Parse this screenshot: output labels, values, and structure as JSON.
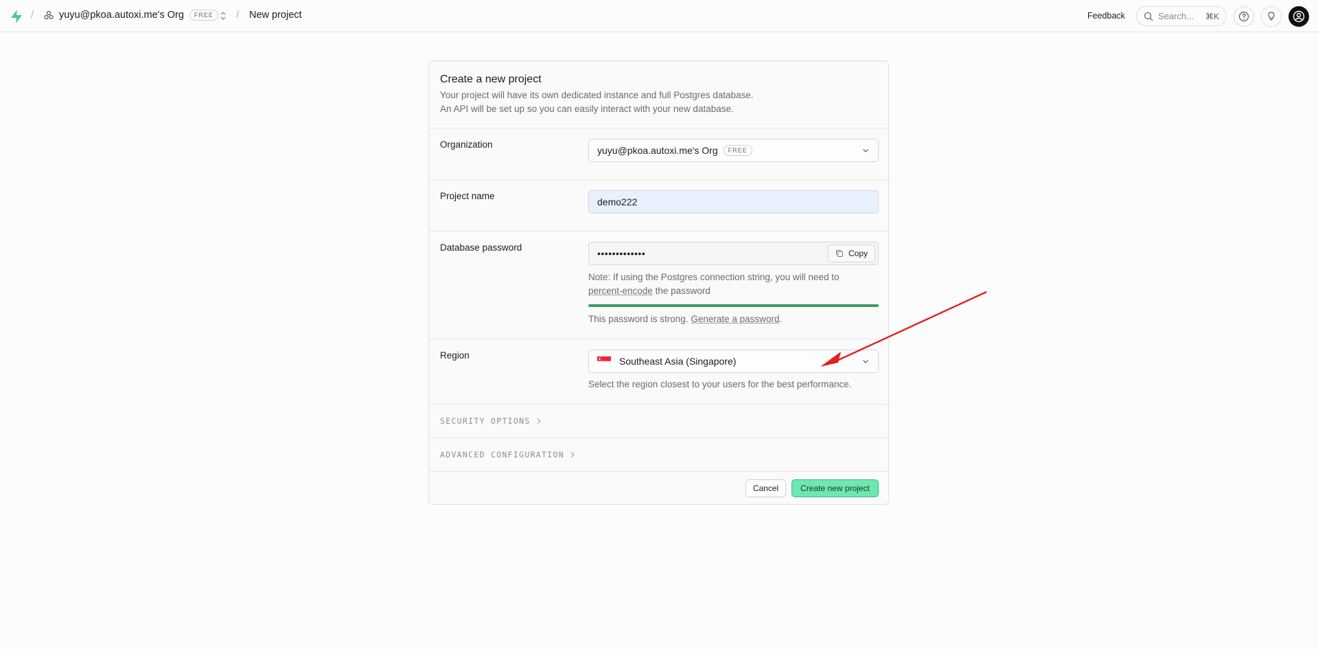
{
  "topbar": {
    "separator": "/",
    "org_name": "yuyu@pkoa.autoxi.me's Org",
    "org_badge": "FREE",
    "project_crumb": "New project",
    "feedback_label": "Feedback",
    "search_placeholder": "Search...",
    "search_shortcut": "⌘K"
  },
  "card": {
    "title": "Create a new project",
    "description_line1": "Your project will have its own dedicated instance and full Postgres database.",
    "description_line2": "An API will be set up so you can easily interact with your new database."
  },
  "form": {
    "organization": {
      "label": "Organization",
      "value": "yuyu@pkoa.autoxi.me's Org",
      "badge": "FREE"
    },
    "project_name": {
      "label": "Project name",
      "value": "demo222"
    },
    "database_password": {
      "label": "Database password",
      "masked_value": "•••••••••••••",
      "copy_label": "Copy",
      "note_part1": "Note: If using the Postgres connection string, you will need to",
      "note_link": "percent-encode",
      "note_part2": "the password",
      "strength_fraction": 1.0,
      "strength_text": "This password is strong.",
      "generate_link": "Generate a password",
      "generate_suffix": "."
    },
    "region": {
      "label": "Region",
      "value": "Southeast Asia (Singapore)",
      "hint": "Select the region closest to your users for the best performance."
    },
    "security_options_label": "SECURITY OPTIONS",
    "advanced_configuration_label": "ADVANCED CONFIGURATION"
  },
  "actions": {
    "cancel_label": "Cancel",
    "create_label": "Create new project"
  },
  "colors": {
    "brand_green": "#3ecf8e",
    "create_button": "#6ee7b0",
    "strength_bar": "#3b9b6a",
    "annotation_arrow": "#e02020"
  }
}
